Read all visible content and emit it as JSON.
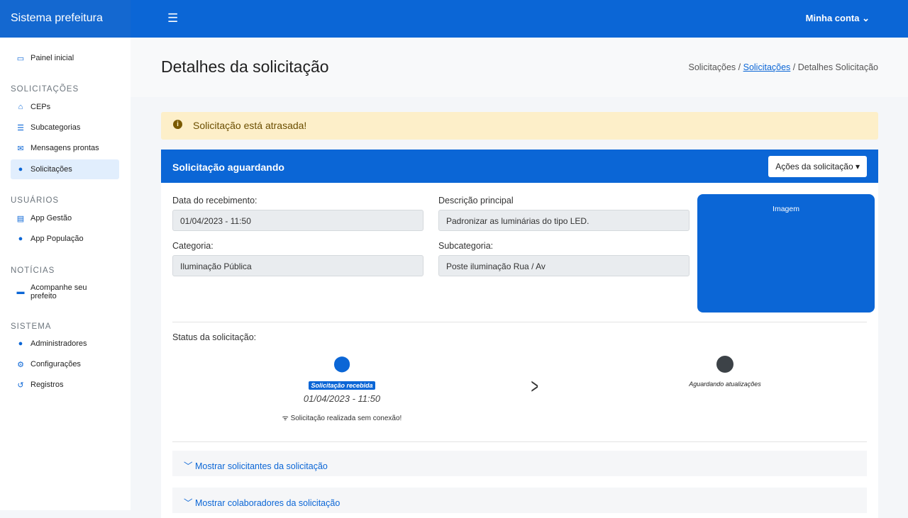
{
  "app": {
    "title": "Sistema prefeitura",
    "account": "Minha conta",
    "menu_icon": "hamburger-icon"
  },
  "sidebar": {
    "home": "Painel inicial",
    "sections": [
      {
        "title": "SOLICITAÇÕES",
        "items": [
          {
            "label": "CEPs",
            "icon": "home-icon"
          },
          {
            "label": "Subcategorias",
            "icon": "list-icon"
          },
          {
            "label": "Mensagens prontas",
            "icon": "envelope-icon"
          },
          {
            "label": "Solicitações",
            "icon": "map-pin-icon",
            "active": true
          }
        ]
      },
      {
        "title": "USUÁRIOS",
        "items": [
          {
            "label": "App Gestão",
            "icon": "id-card-icon"
          },
          {
            "label": "App População",
            "icon": "user-icon"
          }
        ]
      },
      {
        "title": "NOTÍCIAS",
        "items": [
          {
            "label": "Acompanhe seu prefeito",
            "icon": "newspaper-icon"
          }
        ]
      },
      {
        "title": "SISTEMA",
        "items": [
          {
            "label": "Administradores",
            "icon": "user-gear-icon"
          },
          {
            "label": "Configurações",
            "icon": "gear-icon"
          },
          {
            "label": "Registros",
            "icon": "history-icon"
          }
        ]
      }
    ]
  },
  "page": {
    "title": "Detalhes da solicitação",
    "breadcrumb": [
      "Solicitações",
      "Solicitações",
      "Detalhes Solicitação"
    ]
  },
  "alert": "Solicitação está atrasada!",
  "card": {
    "title": "Solicitação aguardando",
    "actions": "Ações da solicitação",
    "fields": {
      "date_label": "Data do recebimento:",
      "date": "01/04/2023 - 11:50",
      "desc_label": "Descrição principal",
      "desc": "Padronizar as luminárias do tipo LED.",
      "cat_label": "Categoria:",
      "cat": "Iluminação Pública",
      "subcat_label": "Subcategoria:",
      "subcat": "Poste iluminação Rua / Av"
    },
    "image_label": "Imagem",
    "status_label": "Status da solicitação:",
    "steps": {
      "received": "Solicitação recebida",
      "received_date": "01/04/2023 - 11:50",
      "offline_note": "Solicitação realizada sem conexão!",
      "waiting": "Aguardando atualizações"
    },
    "accordions": [
      "Mostrar solicitantes da solicitação",
      "Mostrar colaboradores da solicitação"
    ]
  }
}
